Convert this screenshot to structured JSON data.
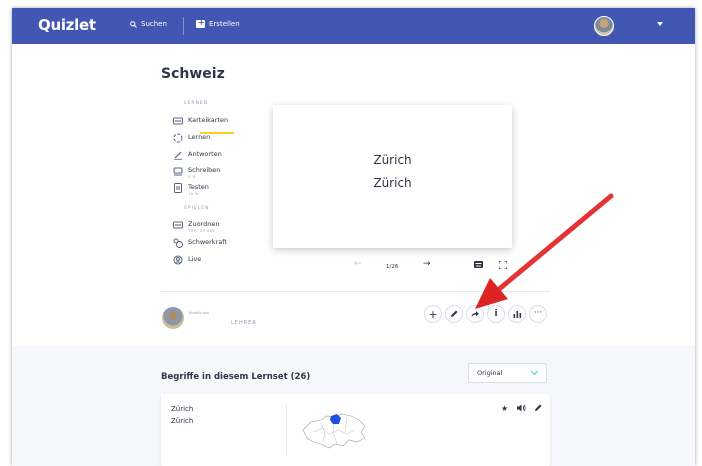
{
  "header": {
    "logo": "Quizlet",
    "search_label": "Suchen",
    "create_label": "Erstellen"
  },
  "set": {
    "title": "Schweiz"
  },
  "sidebar": {
    "section_learn": "LERNEN",
    "section_play": "SPIELEN",
    "items": [
      {
        "label": "Karteikarten",
        "icon": "cards-icon",
        "sub": ""
      },
      {
        "label": "Lernen",
        "icon": "learn-icon",
        "sub": ""
      },
      {
        "label": "Antworten",
        "icon": "pen-icon",
        "sub": ""
      },
      {
        "label": "Schreiben",
        "icon": "write-icon",
        "sub": "0 %"
      },
      {
        "label": "Testen",
        "icon": "test-icon",
        "sub": "70 %"
      },
      {
        "label": "Zuordnen",
        "icon": "match-icon",
        "sub": "TOP: 33 SEK"
      },
      {
        "label": "Schwerkraft",
        "icon": "gravity-icon",
        "sub": ""
      },
      {
        "label": "Live",
        "icon": "live-icon",
        "sub": ""
      }
    ]
  },
  "flashcard": {
    "term": "Zürich",
    "definition": "Zürich",
    "counter": "1/26"
  },
  "creator": {
    "created_by": "Erstellt von",
    "role": "LEHRER"
  },
  "terms": {
    "heading": "Begriffe in diesem Lernset (26)",
    "sort_selected": "Original",
    "items": [
      {
        "term": "Zürich",
        "definition": "Zürich"
      }
    ]
  },
  "colors": {
    "brand": "#4257b2",
    "active": "#ffcd1f",
    "annotation_arrow": "#e52b2b"
  }
}
